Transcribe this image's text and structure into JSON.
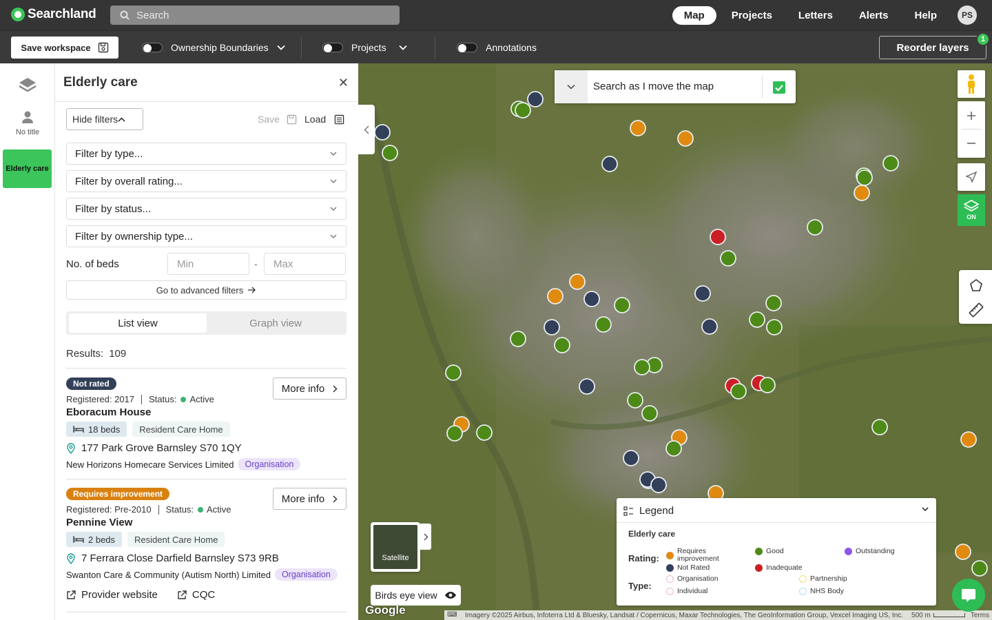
{
  "app": {
    "name": "Searchland",
    "search_placeholder": "Search"
  },
  "nav": {
    "items": [
      "Map",
      "Projects",
      "Letters",
      "Alerts",
      "Help"
    ],
    "active": "Map",
    "avatar": "PS"
  },
  "toolbar": {
    "save_workspace": "Save workspace",
    "ownership": "Ownership Boundaries",
    "projects": "Projects",
    "annotations": "Annotations",
    "reorder": "Reorder layers",
    "reorder_badge": "1"
  },
  "rail": {
    "user_label": "No title",
    "active_label": "Elderly care"
  },
  "panel": {
    "title": "Elderly care",
    "hide_filters": "Hide filters",
    "save": "Save",
    "load": "Load",
    "filters": [
      "Filter by type...",
      "Filter by overall rating...",
      "Filter by status...",
      "Filter by ownership type..."
    ],
    "beds_label": "No. of beds",
    "min_placeholder": "Min",
    "max_placeholder": "Max",
    "advanced": "Go to advanced filters",
    "views": [
      "List view",
      "Graph view"
    ],
    "results_label": "Results:",
    "results_count": "109"
  },
  "results": [
    {
      "rating": "Not rated",
      "registered": "Registered: 2017",
      "status_label": "Status:",
      "status": "Active",
      "name": "Eboracum House",
      "beds": "18 beds",
      "type": "Resident Care Home",
      "address": "177 Park Grove Barnsley S70 1QY",
      "provider": "New Horizons Homecare Services Limited",
      "ownership": "Organisation",
      "more_info": "More info"
    },
    {
      "rating": "Requires improvement",
      "registered": "Registered: Pre-2010",
      "status_label": "Status:",
      "status": "Active",
      "name": "Pennine View",
      "beds": "2 beds",
      "type": "Resident Care Home",
      "address": "7 Ferrara Close Darfield Barnsley S73 9RB",
      "provider": "Swanton Care & Community (Autism North) Limited",
      "ownership": "Organisation",
      "more_info": "More info",
      "provider_website": "Provider website",
      "cqc": "CQC"
    }
  ],
  "map": {
    "search_move": "Search as I move the map",
    "layers_on": "ON",
    "satellite": "Satellite",
    "birds_eye": "Birds eye view",
    "google": "Google",
    "attribution": "Imagery ©2025 Airbus, Infoterra Ltd & Bluesky, Landsat / Copernicus, Maxar Technologies, The GeoInformation Group, Vexcel Imaging US, Inc.",
    "scale": "500 m",
    "terms": "Terms"
  },
  "legend": {
    "title": "Legend",
    "subtitle": "Elderly care",
    "rating_label": "Rating:",
    "type_label": "Type:",
    "ratings": [
      {
        "label": "Requires improvement",
        "color": "#e08a10"
      },
      {
        "label": "Good",
        "color": "#4e8a18"
      },
      {
        "label": "Outstanding",
        "color": "#8e55e8"
      },
      {
        "label": "Not Rated",
        "color": "#33405a"
      },
      {
        "label": "Inadequate",
        "color": "#cc1f25"
      }
    ],
    "types": [
      {
        "label": "Organisation",
        "color": "#f2b8c8"
      },
      {
        "label": "Partnership",
        "color": "#f0dc70"
      },
      {
        "label": "Individual",
        "color": "#f2b8c8"
      },
      {
        "label": "NHS Body",
        "color": "#aee0ee"
      }
    ]
  },
  "colors": {
    "brand": "#3cc55a",
    "topbar": "#353535",
    "toolbar": "#3a3a3a"
  }
}
